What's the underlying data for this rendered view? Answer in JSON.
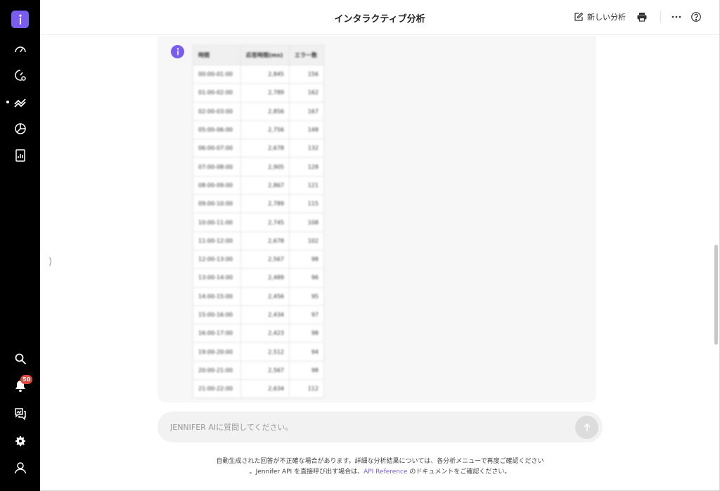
{
  "header": {
    "title": "インタラクティブ分析",
    "new_analysis_label": "新しい分析"
  },
  "sidebar": {
    "notification_count": "50"
  },
  "table": {
    "headers": [
      "時間",
      "応答時間(ms)",
      "エラー数"
    ],
    "rows": [
      [
        "00:00-01:00",
        "2,845",
        "156"
      ],
      [
        "01:00-02:00",
        "2,789",
        "162"
      ],
      [
        "02:00-03:00",
        "2,856",
        "167"
      ],
      [
        "05:00-06:00",
        "2,756",
        "148"
      ],
      [
        "06:00-07:00",
        "2,678",
        "132"
      ],
      [
        "07:00-08:00",
        "2,905",
        "128"
      ],
      [
        "08:00-09:00",
        "2,867",
        "121"
      ],
      [
        "09:00-10:00",
        "2,789",
        "115"
      ],
      [
        "10:00-11:00",
        "2,745",
        "108"
      ],
      [
        "11:00-12:00",
        "2,678",
        "102"
      ],
      [
        "12:00-13:00",
        "2,567",
        "98"
      ],
      [
        "13:00-14:00",
        "2,489",
        "96"
      ],
      [
        "14:00-15:00",
        "2,456",
        "95"
      ],
      [
        "15:00-16:00",
        "2,434",
        "97"
      ],
      [
        "16:00-17:00",
        "2,423",
        "98"
      ],
      [
        "19:00-20:00",
        "2,512",
        "94"
      ],
      [
        "20:00-21:00",
        "2,567",
        "98"
      ],
      [
        "21:00-22:00",
        "2,634",
        "112"
      ]
    ]
  },
  "input": {
    "placeholder": "JENNIFER AIに質問してください。"
  },
  "footer": {
    "line1": "自動生成された回答が不正確な場合があります。詳細な分析結果については、各分析メニューで再度ご確認ください",
    "line2_prefix": "。Jennifer API を直接呼び出す場合は、",
    "link": "API Reference",
    "line2_suffix": " のドキュメントをご確認ください。"
  },
  "colors": {
    "accent": "#7a5cf0",
    "sidebar_bg": "#000000",
    "badge": "#e0453b"
  }
}
